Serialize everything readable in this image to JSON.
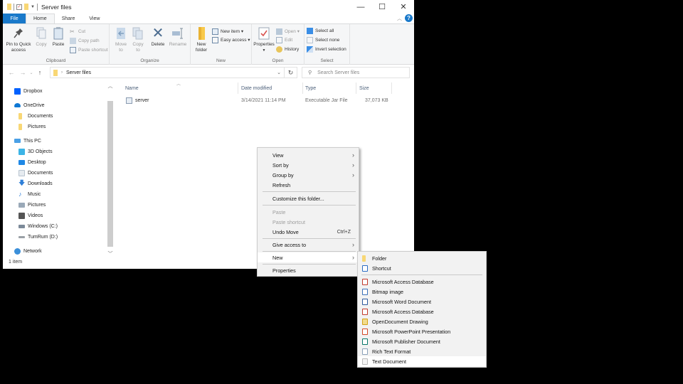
{
  "window": {
    "title": "Server files",
    "controls": {
      "minimize": "—",
      "maximize": "☐",
      "close": "✕"
    }
  },
  "tabs": [
    {
      "label": "File"
    },
    {
      "label": "Home"
    },
    {
      "label": "Share"
    },
    {
      "label": "View"
    }
  ],
  "ribbon": {
    "clipboard": {
      "label": "Clipboard",
      "pin": "Pin to Quick access",
      "copy": "Copy",
      "paste": "Paste",
      "cut": "Cut",
      "copy_path": "Copy path",
      "paste_shortcut": "Paste shortcut"
    },
    "organize": {
      "label": "Organize",
      "move_to": "Move to",
      "copy_to": "Copy to",
      "delete": "Delete",
      "rename": "Rename"
    },
    "new": {
      "label": "New",
      "new_folder": "New folder",
      "new_item": "New item ▾",
      "easy_access": "Easy access ▾"
    },
    "open": {
      "label": "Open",
      "properties": "Properties",
      "open": "Open ▾",
      "edit": "Edit",
      "history": "History"
    },
    "select": {
      "label": "Select",
      "select_all": "Select all",
      "select_none": "Select none",
      "invert": "Invert selection"
    }
  },
  "address": {
    "path": "Server files",
    "search_placeholder": "Search Server files"
  },
  "nav": {
    "items": [
      {
        "label": "Dropbox",
        "icon": "dropbox-icon",
        "color": "#0061fe"
      },
      {
        "label": "OneDrive",
        "icon": "cloud-icon",
        "color": "#0f78d4"
      },
      {
        "label": "Documents",
        "icon": "folder-icon",
        "color": "#f8d775"
      },
      {
        "label": "Pictures",
        "icon": "folder-icon",
        "color": "#f8d775"
      },
      {
        "label": "This PC",
        "icon": "computer-icon",
        "color": "#4aa0e6"
      },
      {
        "label": "3D Objects",
        "icon": "cube-icon",
        "color": "#3cb4e6"
      },
      {
        "label": "Desktop",
        "icon": "desktop-icon",
        "color": "#1e88e5"
      },
      {
        "label": "Documents",
        "icon": "documents-icon",
        "color": "#b8c4cf"
      },
      {
        "label": "Downloads",
        "icon": "download-icon",
        "color": "#2f7fd8"
      },
      {
        "label": "Music",
        "icon": "music-icon",
        "color": "#2f7fd8"
      },
      {
        "label": "Pictures",
        "icon": "pictures-icon",
        "color": "#9aa9b8"
      },
      {
        "label": "Videos",
        "icon": "videos-icon",
        "color": "#555"
      },
      {
        "label": "Windows (C:)",
        "icon": "drive-icon",
        "color": "#7c8a99"
      },
      {
        "label": "TumRum (D:)",
        "icon": "drive-icon",
        "color": "#9aa0a6"
      },
      {
        "label": "Network",
        "icon": "network-icon",
        "color": "#3b8fd9"
      }
    ]
  },
  "files": {
    "columns": [
      "Name",
      "Date modified",
      "Type",
      "Size"
    ],
    "rows": [
      {
        "name": "server",
        "date": "3/14/2021 11:14 PM",
        "type": "Executable Jar File",
        "size": "37,073 KB"
      }
    ]
  },
  "status": {
    "count": "1 item"
  },
  "context_menu": {
    "items": [
      {
        "label": "View",
        "submenu": true
      },
      {
        "label": "Sort by",
        "submenu": true
      },
      {
        "label": "Group by",
        "submenu": true
      },
      {
        "label": "Refresh"
      },
      {
        "label": "Customize this folder..."
      },
      {
        "label": "Paste",
        "disabled": true
      },
      {
        "label": "Paste shortcut",
        "disabled": true
      },
      {
        "label": "Undo Move",
        "accel": "Ctrl+Z"
      },
      {
        "label": "Give access to",
        "submenu": true
      },
      {
        "label": "New",
        "submenu": true,
        "highlighted": true
      },
      {
        "label": "Properties"
      }
    ]
  },
  "new_submenu": {
    "items": [
      {
        "label": "Folder",
        "icon": "folder-icon",
        "color": "#f8d775"
      },
      {
        "label": "Shortcut",
        "icon": "shortcut-icon",
        "color": "#2b6cc4"
      },
      {
        "label": "Microsoft Access Database",
        "icon": "access-icon",
        "color": "#c0392b"
      },
      {
        "label": "Bitmap image",
        "icon": "bitmap-icon",
        "color": "#3a6fb7"
      },
      {
        "label": "Microsoft Word Document",
        "icon": "word-icon",
        "color": "#2b579a"
      },
      {
        "label": "Microsoft Access Database",
        "icon": "access-icon",
        "color": "#c0392b"
      },
      {
        "label": "OpenDocument Drawing",
        "icon": "draw-icon",
        "color": "#d4a017"
      },
      {
        "label": "Microsoft PowerPoint Presentation",
        "icon": "powerpoint-icon",
        "color": "#d24726"
      },
      {
        "label": "Microsoft Publisher Document",
        "icon": "publisher-icon",
        "color": "#077568"
      },
      {
        "label": "Rich Text Format",
        "icon": "rtf-icon",
        "color": "#8aa0b8"
      },
      {
        "label": "Text Document",
        "icon": "text-document-icon",
        "color": "#c8c8c8",
        "highlighted": true
      }
    ]
  }
}
